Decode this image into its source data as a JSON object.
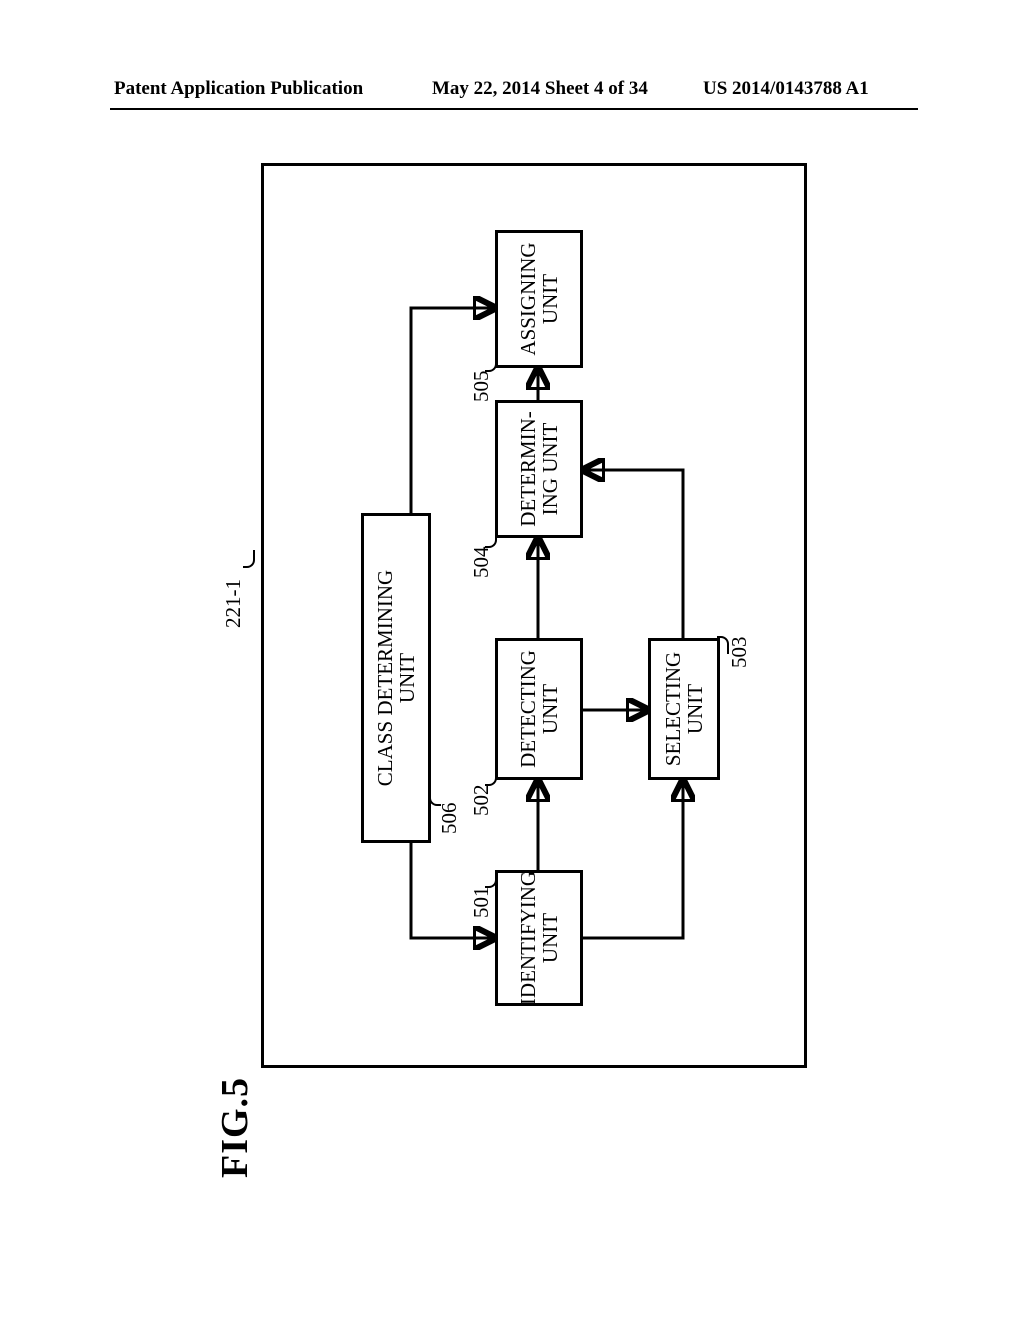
{
  "header": {
    "publication_label": "Patent Application Publication",
    "date_sheet": "May 22, 2014  Sheet 4 of 34",
    "pub_number": "US 2014/0143788 A1"
  },
  "figure": {
    "title": "FIG.5",
    "container_ref": "221-1"
  },
  "blocks": {
    "identifying": {
      "ref": "501",
      "label": "IDENTIFYING\nUNIT"
    },
    "detecting": {
      "ref": "502",
      "label": "DETECTING\nUNIT"
    },
    "selecting": {
      "ref": "503",
      "label": "SELECTING\nUNIT"
    },
    "determining": {
      "ref": "504",
      "label": "DETERMIN-\nING UNIT"
    },
    "assigning": {
      "ref": "505",
      "label": "ASSIGNING\nUNIT"
    },
    "class_det": {
      "ref": "506",
      "label": "CLASS DETERMINING\nUNIT"
    }
  },
  "chart_data": {
    "type": "diagram",
    "title": "FIG.5",
    "container": "221-1",
    "nodes": [
      {
        "id": "501",
        "label": "IDENTIFYING UNIT"
      },
      {
        "id": "502",
        "label": "DETECTING UNIT"
      },
      {
        "id": "503",
        "label": "SELECTING UNIT"
      },
      {
        "id": "504",
        "label": "DETERMINING UNIT"
      },
      {
        "id": "505",
        "label": "ASSIGNING UNIT"
      },
      {
        "id": "506",
        "label": "CLASS DETERMINING UNIT"
      }
    ],
    "edges": [
      {
        "from": "506",
        "to": "501"
      },
      {
        "from": "506",
        "to": "505"
      },
      {
        "from": "501",
        "to": "502"
      },
      {
        "from": "501",
        "to": "503"
      },
      {
        "from": "502",
        "to": "503"
      },
      {
        "from": "502",
        "to": "504"
      },
      {
        "from": "503",
        "to": "504"
      },
      {
        "from": "504",
        "to": "505"
      }
    ]
  }
}
